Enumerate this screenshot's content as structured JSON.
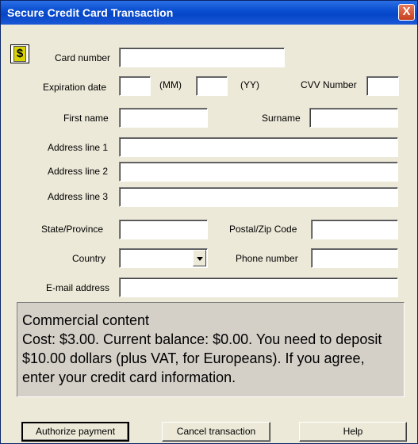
{
  "window": {
    "title": "Secure Credit Card Transaction",
    "close_label": "X"
  },
  "icon": {
    "name": "dollar-icon",
    "glyph": "$"
  },
  "form": {
    "card_number_label": "Card number",
    "expiration_label": "Expiration date",
    "mm_label": "(MM)",
    "yy_label": "(YY)",
    "cvv_label": "CVV Number",
    "first_name_label": "First name",
    "surname_label": "Surname",
    "address1_label": "Address line 1",
    "address2_label": "Address line 2",
    "address3_label": "Address line 3",
    "state_label": "State/Province",
    "postal_label": "Postal/Zip Code",
    "country_label": "Country",
    "phone_label": "Phone number",
    "email_label": "E-mail address",
    "values": {
      "card_number": "",
      "exp_mm": "",
      "exp_yy": "",
      "cvv": "",
      "first_name": "",
      "surname": "",
      "address1": "",
      "address2": "",
      "address3": "",
      "state": "",
      "postal": "",
      "country": "",
      "phone": "",
      "email": ""
    }
  },
  "info": {
    "line1": "Commercial content",
    "line2": "Cost: $3.00. Current balance: $0.00. You need to deposit $10.00 dollars (plus VAT, for Europeans). If you agree, enter your credit card information."
  },
  "buttons": {
    "authorize": "Authorize payment",
    "cancel": "Cancel transaction",
    "help": "Help"
  }
}
